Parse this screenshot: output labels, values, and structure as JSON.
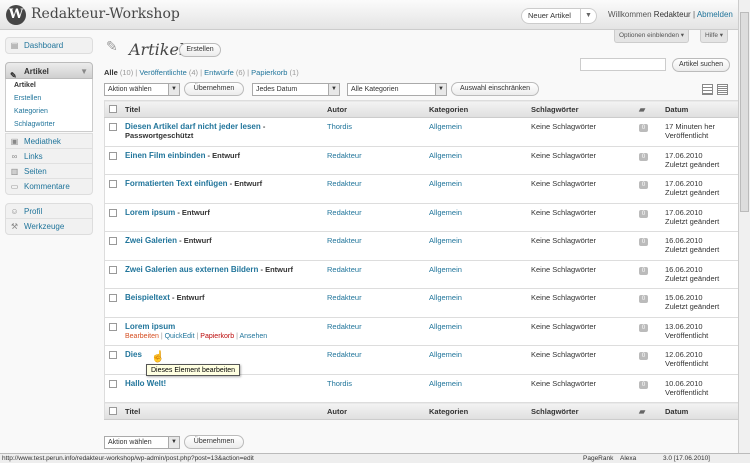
{
  "header": {
    "logo": "W",
    "site_title": "Redakteur-Workshop",
    "new_post_label": "Neuer Artikel",
    "welcome": "Willkommen",
    "user": "Redakteur",
    "separator": "|",
    "logout": "Abmelden",
    "screen_options": "Optionen einblenden ▾",
    "help": "Hilfe ▾"
  },
  "sidebar": {
    "dashboard": "Dashboard",
    "artikel": "Artikel",
    "sub": [
      "Artikel",
      "Erstellen",
      "Kategorien",
      "Schlagwörter"
    ],
    "mediathek": "Mediathek",
    "links": "Links",
    "seiten": "Seiten",
    "kommentare": "Kommentare",
    "profil": "Profil",
    "werkzeuge": "Werkzeuge"
  },
  "page": {
    "title": "Artikel",
    "create_button": "Erstellen",
    "search_button": "Artikel suchen",
    "filters": {
      "all": "Alle",
      "all_count": "(10)",
      "published": "Veröffentlichte",
      "published_count": "(4)",
      "drafts": "Entwürfe",
      "drafts_count": "(6)",
      "trash": "Papierkorb",
      "trash_count": "(1)",
      "sep": "|"
    },
    "bulk_select": "Aktion wählen",
    "apply_button": "Übernehmen",
    "date_select": "Jedes Datum",
    "cat_select": "Alle Kategorien",
    "filter_button": "Auswahl einschränken"
  },
  "table": {
    "headers": {
      "title": "Titel",
      "author": "Autor",
      "categories": "Kategorien",
      "tags": "Schlagwörter",
      "date": "Datum"
    },
    "rows": [
      {
        "title": "Diesen Artikel darf nicht jeder lesen",
        "state": "Passwortgeschützt",
        "author": "Thordis",
        "category": "Allgemein",
        "tags": "Keine Schlagwörter",
        "comments": "0",
        "date": "17 Minuten her",
        "status": "Veröffentlicht"
      },
      {
        "title": "Einen Film einbinden",
        "state": "Entwurf",
        "author": "Redakteur",
        "category": "Allgemein",
        "tags": "Keine Schlagwörter",
        "comments": "0",
        "date": "17.06.2010",
        "status": "Zuletzt geändert"
      },
      {
        "title": "Formatierten Text einfügen",
        "state": "Entwurf",
        "author": "Redakteur",
        "category": "Allgemein",
        "tags": "Keine Schlagwörter",
        "comments": "0",
        "date": "17.06.2010",
        "status": "Zuletzt geändert"
      },
      {
        "title": "Lorem ipsum",
        "state": "Entwurf",
        "author": "Redakteur",
        "category": "Allgemein",
        "tags": "Keine Schlagwörter",
        "comments": "0",
        "date": "17.06.2010",
        "status": "Zuletzt geändert"
      },
      {
        "title": "Zwei Galerien",
        "state": "Entwurf",
        "author": "Redakteur",
        "category": "Allgemein",
        "tags": "Keine Schlagwörter",
        "comments": "0",
        "date": "16.06.2010",
        "status": "Zuletzt geändert"
      },
      {
        "title": "Zwei Galerien aus externen Bildern",
        "state": "Entwurf",
        "author": "Redakteur",
        "category": "Allgemein",
        "tags": "Keine Schlagwörter",
        "comments": "0",
        "date": "16.06.2010",
        "status": "Zuletzt geändert"
      },
      {
        "title": "Beispieltext",
        "state": "Entwurf",
        "author": "Redakteur",
        "category": "Allgemein",
        "tags": "Keine Schlagwörter",
        "comments": "0",
        "date": "15.06.2010",
        "status": "Zuletzt geändert"
      },
      {
        "title": "Lorem ipsum",
        "state": "",
        "author": "Redakteur",
        "category": "Allgemein",
        "tags": "Keine Schlagwörter",
        "comments": "0",
        "date": "13.06.2010",
        "status": "Veröffentlicht"
      },
      {
        "title": "Dies",
        "state": "",
        "author": "Redakteur",
        "category": "Allgemein",
        "tags": "Keine Schlagwörter",
        "comments": "0",
        "date": "12.06.2010",
        "status": "Veröffentlicht"
      },
      {
        "title": "Hallo Welt!",
        "state": "",
        "author": "Thordis",
        "category": "Allgemein",
        "tags": "Keine Schlagwörter",
        "comments": "0",
        "date": "10.06.2010",
        "status": "Veröffentlicht"
      }
    ],
    "row_actions": {
      "edit": "Bearbeiten",
      "quickedit": "QuickEdit",
      "trash": "Papierkorb",
      "view": "Ansehen",
      "sep": "|"
    }
  },
  "tooltip": "Dieses Element bearbeiten",
  "status": {
    "url": "http://www.test.perun.info/redakteur-workshop/wp-admin/post.php?post=13&action=edit",
    "pagerank": "PageRank",
    "alexa": "Alexa",
    "version": "3.0 [17.06.2010]"
  },
  "colors": {
    "link": "#21759b",
    "edit": "#d54e21",
    "trash": "#bc0b0b"
  }
}
